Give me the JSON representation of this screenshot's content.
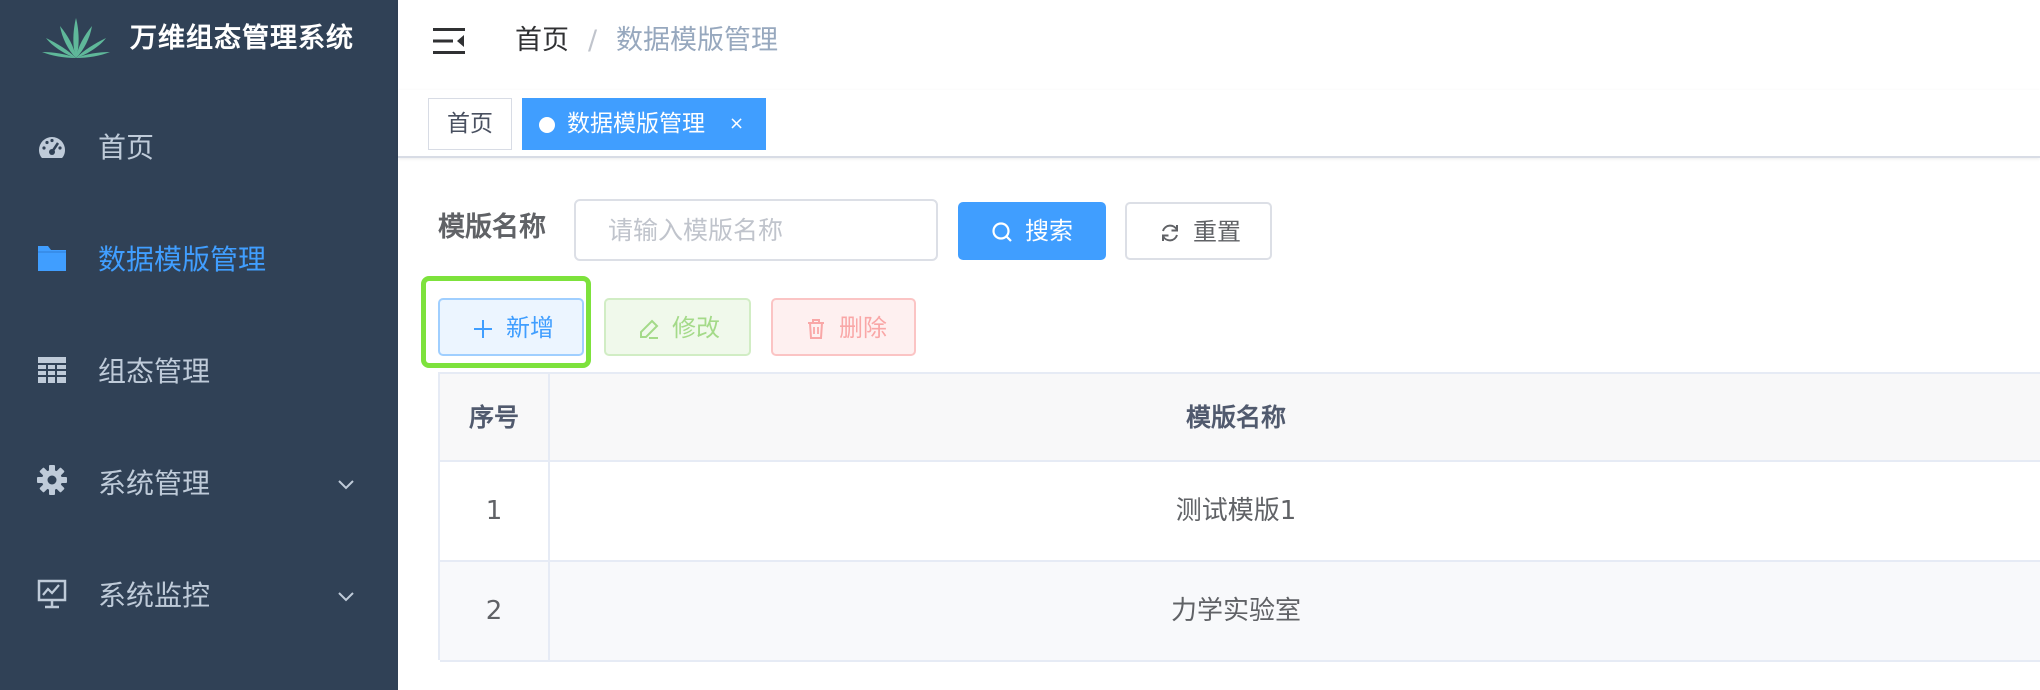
{
  "app": {
    "title": "万维组态管理系统"
  },
  "sidebar": {
    "items": [
      {
        "label": "首页",
        "icon": "dashboard-icon"
      },
      {
        "label": "数据模版管理",
        "icon": "folder-icon",
        "active": true
      },
      {
        "label": "组态管理",
        "icon": "grid-icon"
      },
      {
        "label": "系统管理",
        "icon": "gear-icon",
        "expandable": true
      },
      {
        "label": "系统监控",
        "icon": "monitor-icon",
        "expandable": true
      }
    ]
  },
  "header": {
    "breadcrumb": {
      "home": "首页",
      "separator": "/",
      "current": "数据模版管理"
    }
  },
  "tags": {
    "home": "首页",
    "active": "数据模版管理",
    "close": "×"
  },
  "search": {
    "label": "模版名称",
    "placeholder": "请输入模版名称",
    "value": "",
    "search_label": "搜索",
    "reset_label": "重置"
  },
  "toolbar": {
    "add_label": "新增",
    "edit_label": "修改",
    "delete_label": "删除"
  },
  "table": {
    "columns": [
      "序号",
      "模版名称"
    ],
    "rows": [
      {
        "index": "1",
        "name": "测试模版1"
      },
      {
        "index": "2",
        "name": "力学实验室"
      }
    ]
  },
  "colors": {
    "sidebar_bg": "#304156",
    "sidebar_text": "#bfcbd9",
    "accent": "#409eff",
    "highlight": "#7de23c"
  }
}
